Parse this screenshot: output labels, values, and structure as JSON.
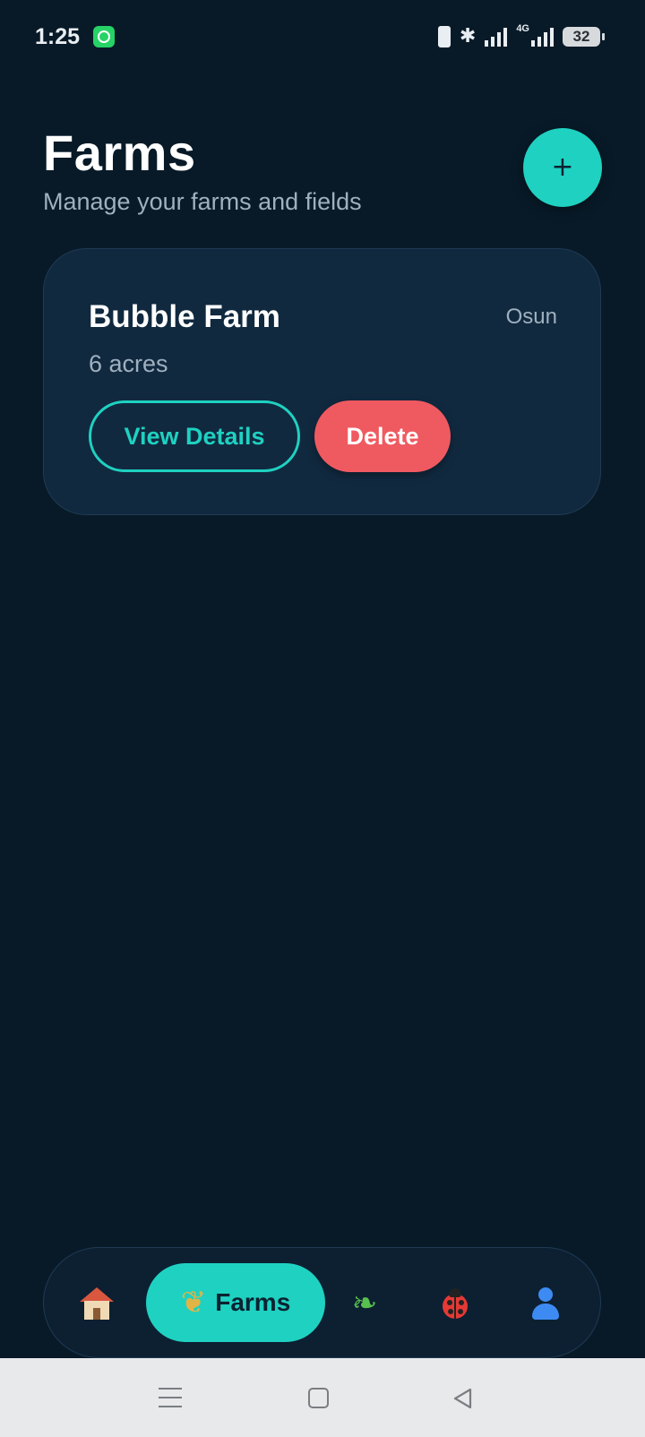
{
  "status_bar": {
    "time": "1:25",
    "network_label": "4G",
    "battery": "32",
    "icons": [
      "whatsapp-icon",
      "vibrate-icon",
      "bluetooth-icon",
      "signal-icon",
      "signal-4g-icon",
      "battery-icon"
    ]
  },
  "header": {
    "title": "Farms",
    "subtitle": "Manage your farms and fields",
    "add_button_label": "+"
  },
  "farms": [
    {
      "name": "Bubble Farm",
      "size": "6 acres",
      "location": "Osun",
      "view_label": "View Details",
      "delete_label": "Delete"
    }
  ],
  "bottom_nav": {
    "items": [
      {
        "icon": "house-icon",
        "label": ""
      },
      {
        "icon": "wheat-icon",
        "label": "Farms",
        "active": true
      },
      {
        "icon": "herb-icon",
        "label": ""
      },
      {
        "icon": "ladybug-icon",
        "label": ""
      },
      {
        "icon": "person-icon",
        "label": ""
      }
    ]
  },
  "system_nav": {
    "icons": [
      "menu-icon",
      "home-square-icon",
      "back-triangle-icon"
    ]
  },
  "colors": {
    "background": "#081a28",
    "card": "#11293f",
    "accent": "#1fd1c1",
    "danger": "#ef5a60",
    "muted_text": "#9fb0bf"
  }
}
